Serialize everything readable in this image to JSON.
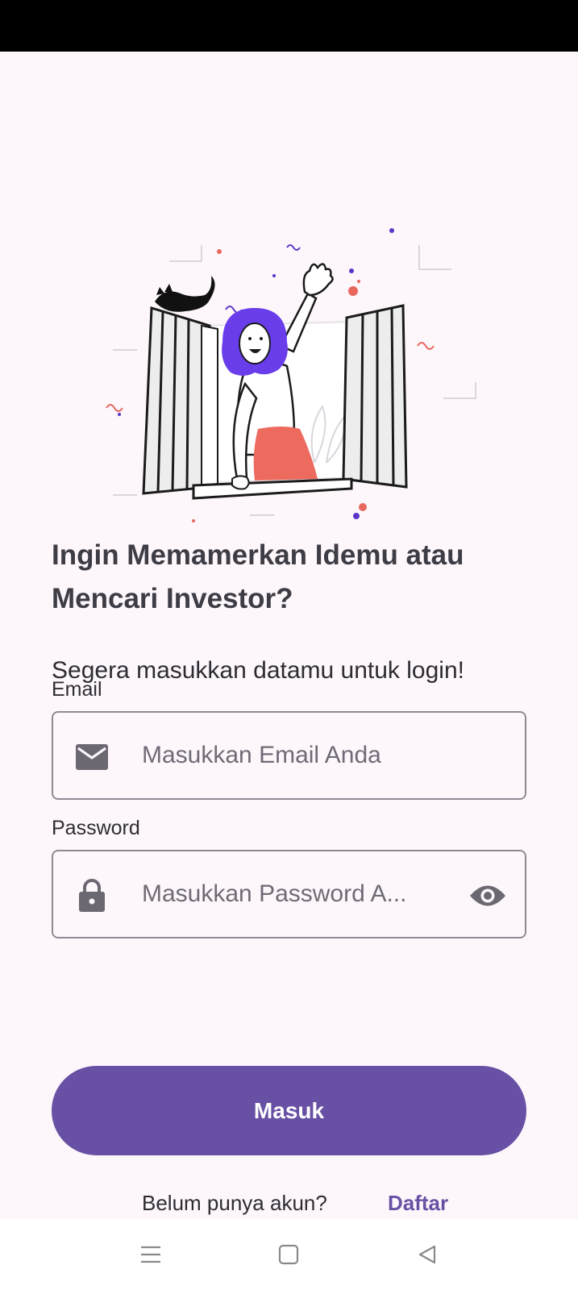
{
  "colors": {
    "primary": "#6851A4",
    "background": "#FDF7FC",
    "text": "#2E2C33",
    "outline": "#8E8A94"
  },
  "hero": {
    "illustration_icon": "woman-waving-at-window-illustration"
  },
  "headline": "Ingin Memamerkan Idemu atau Mencari Investor?",
  "subheadline": "Segera masukkan datamu untuk login!",
  "email": {
    "label": "Email",
    "placeholder": "Masukkan Email Anda",
    "value": "",
    "icon": "mail-icon"
  },
  "password": {
    "label": "Password",
    "placeholder": "Masukkan Password A...",
    "value": "",
    "icon": "lock-icon",
    "toggle_icon": "eye-icon"
  },
  "login_button": "Masuk",
  "signup": {
    "prompt": "Belum punya akun?",
    "link": "Daftar"
  },
  "navigation": {
    "recents_icon": "menu-icon",
    "home_icon": "square-icon",
    "back_icon": "triangle-back-icon"
  }
}
